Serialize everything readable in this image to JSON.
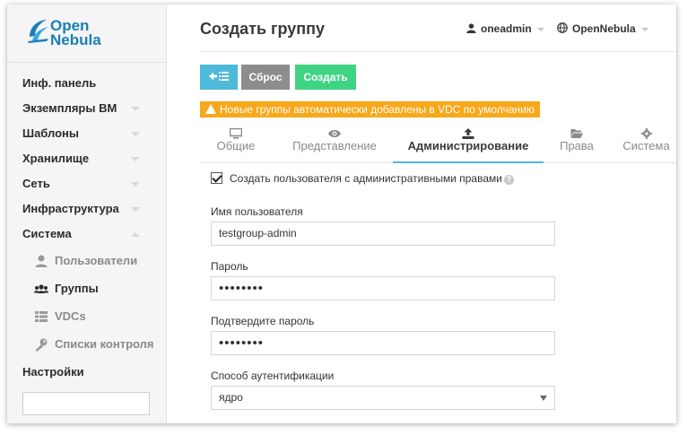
{
  "logo": {
    "line1": "Open",
    "line2": "Nebula"
  },
  "sidebar": {
    "items": [
      {
        "label": "Инф. панель"
      },
      {
        "label": "Экземпляры ВМ"
      },
      {
        "label": "Шаблоны"
      },
      {
        "label": "Хранилище"
      },
      {
        "label": "Сеть"
      },
      {
        "label": "Инфраструктура"
      },
      {
        "label": "Система"
      }
    ],
    "sub_items": [
      {
        "label": "Пользователи",
        "icon": "user-icon"
      },
      {
        "label": "Группы",
        "icon": "users-icon"
      },
      {
        "label": "VDCs",
        "icon": "table-icon"
      },
      {
        "label": "Списки контроля",
        "icon": "key-icon"
      }
    ],
    "settings": "Настройки"
  },
  "header": {
    "title": "Создать группу",
    "user": "oneadmin",
    "zone": "OpenNebula"
  },
  "toolbar": {
    "reset_label": "Сброс",
    "create_label": "Создать"
  },
  "warning": "Новые группы автоматически добавлены в VDC по умолчанию",
  "tabs": [
    {
      "label": "Общие"
    },
    {
      "label": "Представление"
    },
    {
      "label": "Администрирование"
    },
    {
      "label": "Права"
    },
    {
      "label": "Система"
    }
  ],
  "form": {
    "create_admin_label": "Создать пользователя с административными правами",
    "username_label": "Имя пользователя",
    "username_value": "testgroup-admin",
    "password_label": "Пароль",
    "password_value": "••••••••",
    "confirm_label": "Подтвердите пароль",
    "confirm_value": "••••••••",
    "auth_label": "Способ аутентификации",
    "auth_value": "ядро"
  },
  "colors": {
    "accent": "#4fb9d9",
    "reset": "#8d8d8d",
    "create": "#3fd483",
    "warning": "#f7a81b"
  }
}
